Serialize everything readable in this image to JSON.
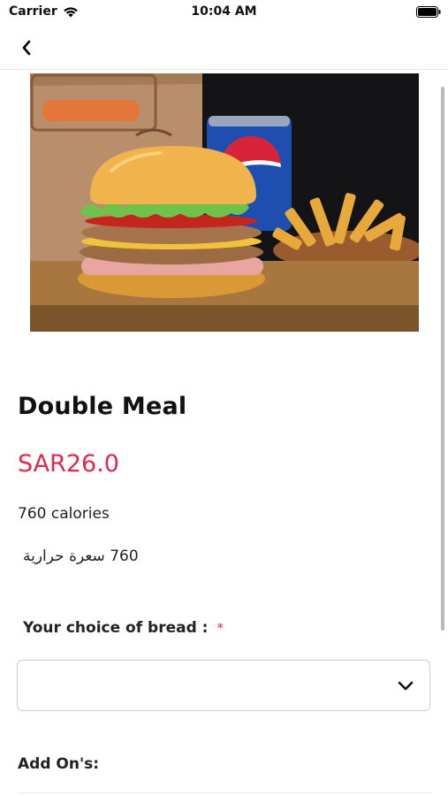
{
  "status_bar": {
    "carrier": "Carrier",
    "time": "10:04 AM"
  },
  "nav": {
    "back_icon": "chevron-left-icon"
  },
  "product": {
    "image_alt": "Burger meal with fries and soda",
    "title": "Double Meal",
    "price": "SAR26.0",
    "calories_en": "760 calories",
    "calories_ar": "760 سعرة حرارية"
  },
  "bread": {
    "label": "Your choice of bread :",
    "required_mark": "*",
    "selected_value": ""
  },
  "addons": {
    "label": "Add On's:"
  },
  "colors": {
    "accent": "#e3264f",
    "border": "#cfcfcf"
  }
}
